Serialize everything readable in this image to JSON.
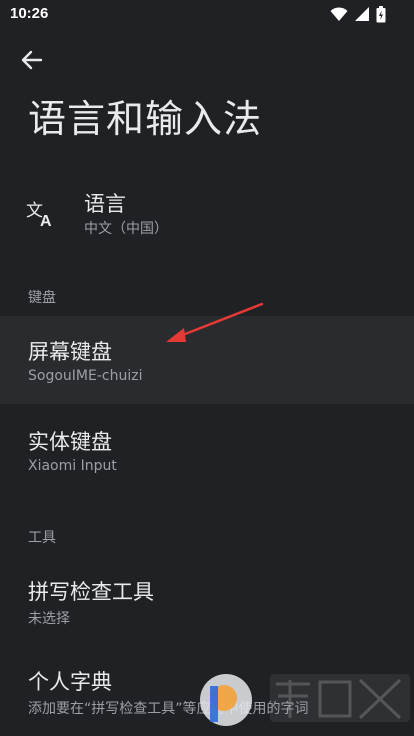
{
  "status_bar": {
    "time": "10:26",
    "icons": [
      "wifi-icon",
      "signal-icon",
      "battery-icon"
    ]
  },
  "header": {
    "back_icon": "arrow-left-icon",
    "title": "语言和输入法"
  },
  "language": {
    "icon": "translate-icon",
    "title": "语言",
    "summary": "中文（中国）"
  },
  "sections": {
    "keyboard": "键盘",
    "tools": "工具"
  },
  "items": {
    "onscreen_keyboard": {
      "title": "屏幕键盘",
      "summary": "SogouIME-chuizi"
    },
    "physical_keyboard": {
      "title": "实体键盘",
      "summary": "Xiaomi Input"
    },
    "spell_checker": {
      "title": "拼写检查工具",
      "summary": "未选择"
    },
    "personal_dictionary": {
      "title": "个人字典",
      "summary": "添加要在“拼写检查工具”等应用中使用的字词"
    }
  },
  "colors": {
    "background": "#202124",
    "highlight": "#2a2b2e",
    "text_primary": "#e8eaed",
    "text_secondary": "#9aa0a6",
    "annotation_arrow": "#e53935"
  }
}
